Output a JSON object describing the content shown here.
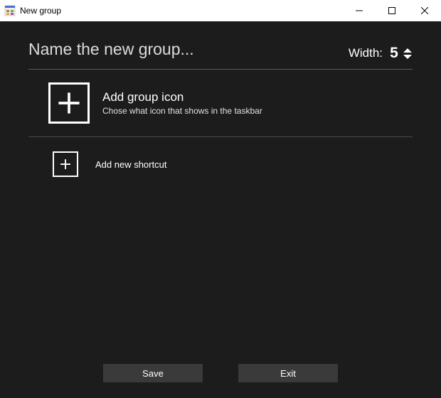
{
  "window": {
    "title": "New group"
  },
  "header": {
    "name_placeholder": "Name the new group...",
    "name_value": "",
    "width_label": "Width:",
    "width_value": "5"
  },
  "group_icon": {
    "title": "Add group icon",
    "subtitle": "Chose what icon that shows in the taskbar"
  },
  "shortcut": {
    "add_label": "Add new shortcut"
  },
  "footer": {
    "save_label": "Save",
    "exit_label": "Exit"
  },
  "icons": {
    "app": "app-icon",
    "plus": "plus-icon",
    "minimize": "minimize-icon",
    "maximize": "maximize-icon",
    "close": "close-icon",
    "arrow_up": "arrow-up-icon",
    "arrow_down": "arrow-down-icon"
  }
}
